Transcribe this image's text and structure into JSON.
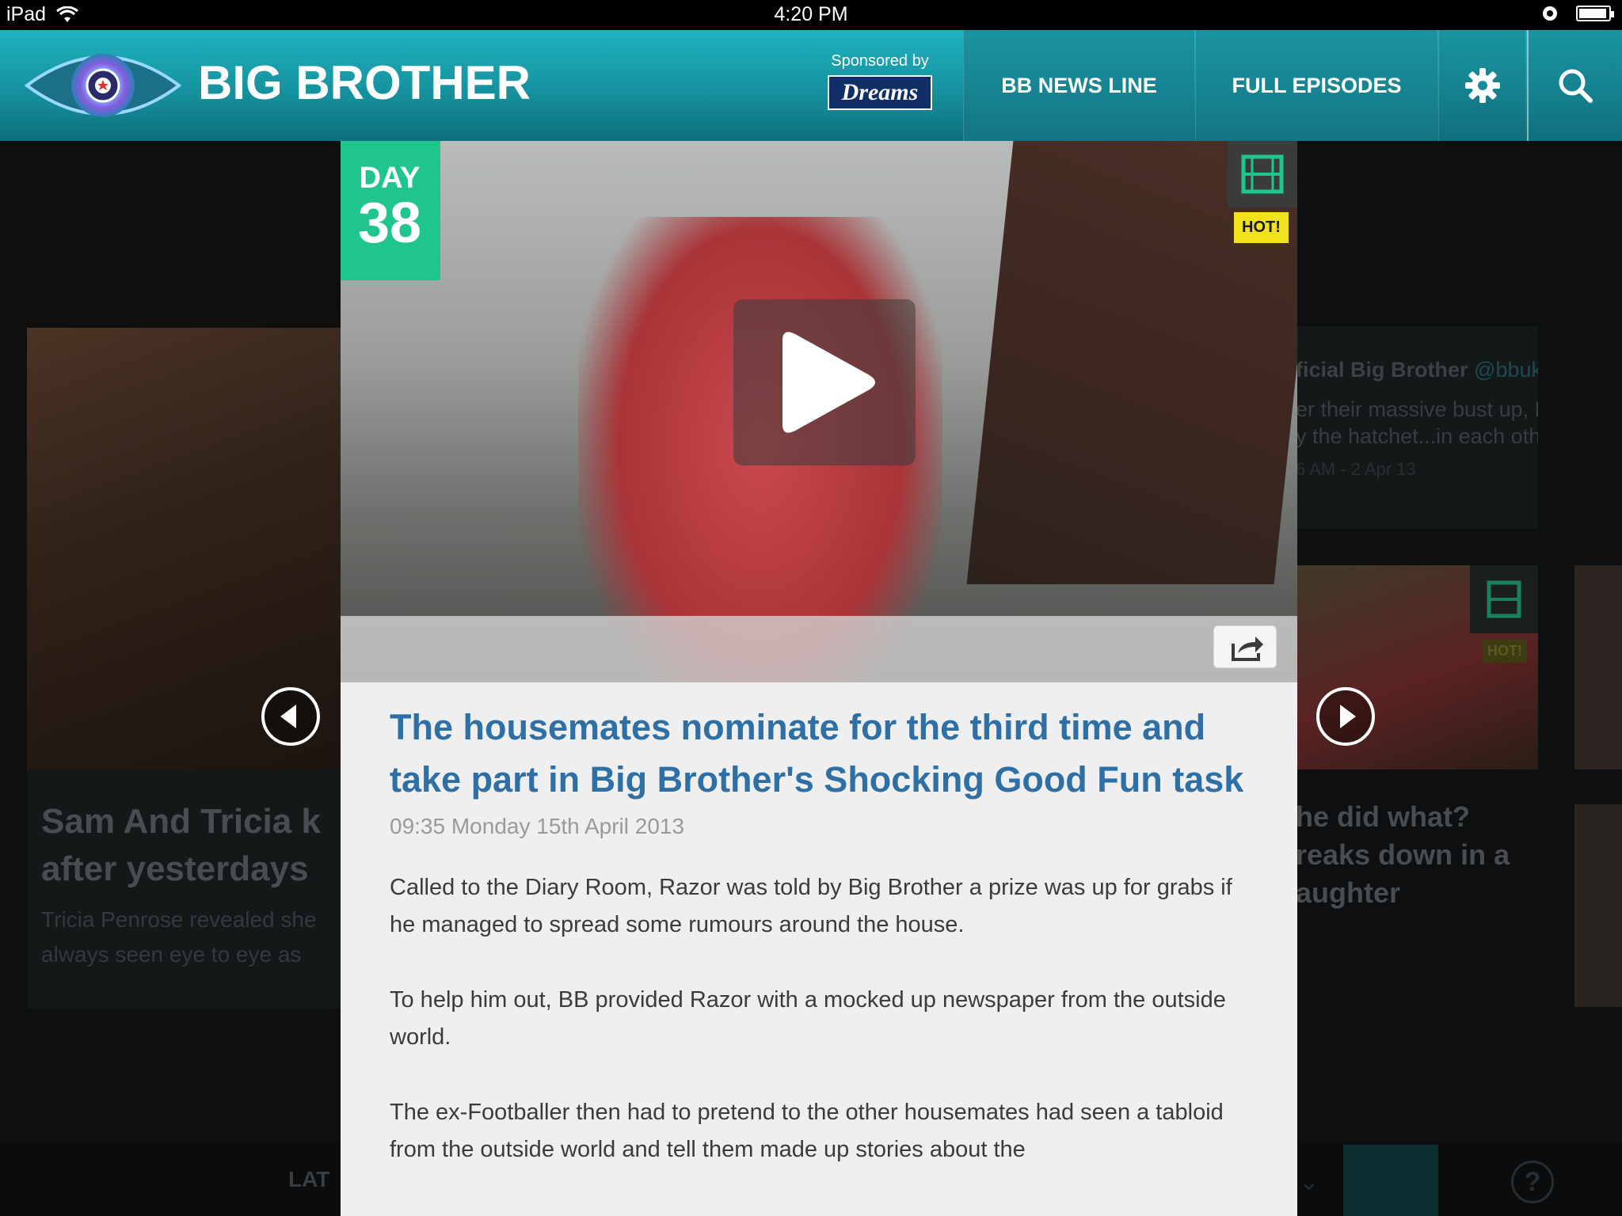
{
  "status_bar": {
    "device": "iPad",
    "time": "4:20 PM"
  },
  "header": {
    "brand": "BIG BROTHER",
    "sponsor_label": "Sponsored by",
    "sponsor_name": "Dreams",
    "nav": {
      "news": "BB NEWS LINE",
      "episodes": "FULL EPISODES"
    }
  },
  "background": {
    "left_story": {
      "title_line1": "Sam And Tricia k",
      "title_line2": "after yesterdays",
      "sub_line1": "Tricia Penrose revealed she",
      "sub_line2": "always seen eye to eye as"
    },
    "tweet": {
      "name": "ficial Big Brother",
      "handle": "@bbuk",
      "line1": "er their massive bust up, Nicola a",
      "line2": "y the hatchet...in each other's ba",
      "date": "6 AM - 2 Apr 13"
    },
    "right_story": {
      "line1": "he did what?",
      "line2": "reaks down in a",
      "line3": "aughter"
    },
    "mini_hot": "HOT!",
    "bottom_label": "LAT"
  },
  "card": {
    "day_label": "DAY",
    "day_number": "38",
    "hot_label": "HOT!",
    "title": "The housemates nominate for the third time and take part in Big Brother's Shocking Good Fun task",
    "date": "09:35 Monday 15th April 2013",
    "paragraphs": [
      "Called to the Diary Room, Razor was told by Big Brother a prize was up for grabs if he managed to spread some rumours around the house.",
      "To help him out, BB provided Razor with a mocked up newspaper from the outside world.",
      "The ex-Footballer then had to pretend to the other housemates had seen a tabloid from the outside world and tell them made up stories about the"
    ]
  },
  "colors": {
    "header_teal": "#1aa3b0",
    "title_blue": "#2e6fa6",
    "day_green": "#1fc58b",
    "hot_yellow": "#f1e21b"
  }
}
